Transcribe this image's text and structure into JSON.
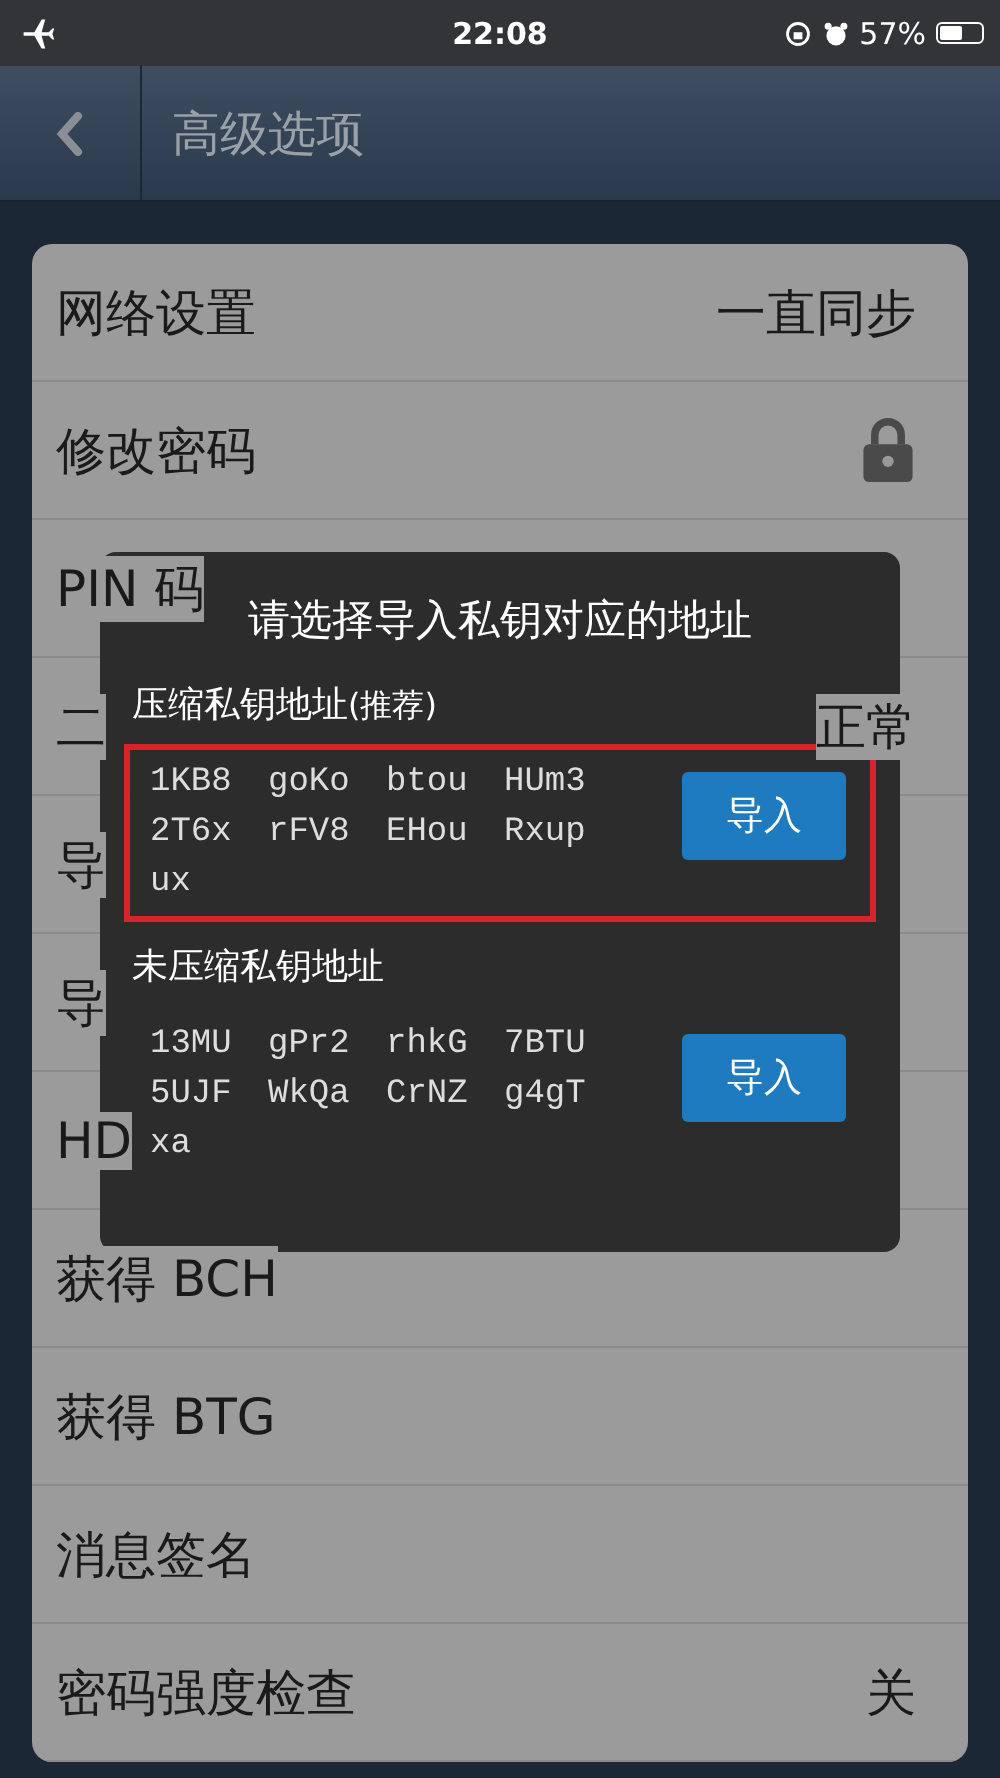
{
  "status_bar": {
    "time": "22:08",
    "battery_percent": "57%",
    "battery": {
      "level": 0.57
    }
  },
  "nav": {
    "title": "高级选项"
  },
  "settings": [
    {
      "kind": "value",
      "label": "网络设置",
      "value": "一直同步"
    },
    {
      "kind": "lock",
      "label": "修改密码"
    },
    {
      "kind": "plain",
      "label": "PIN 码"
    },
    {
      "kind": "value",
      "label": "二",
      "value": "正常"
    },
    {
      "kind": "plain",
      "label": "导"
    },
    {
      "kind": "plain",
      "label": "导"
    },
    {
      "kind": "plain",
      "label": "HD"
    },
    {
      "kind": "plain",
      "label": "获得 BCH"
    },
    {
      "kind": "plain",
      "label": "获得 BTG"
    },
    {
      "kind": "plain",
      "label": "消息签名"
    },
    {
      "kind": "value",
      "label": "密码强度检查",
      "value": "关"
    }
  ],
  "dialog": {
    "title": "请选择导入私钥对应的地址",
    "options": [
      {
        "label": "压缩私钥地址",
        "label_note": "(推荐)",
        "address": "1KB8 goKo btou HUm3 2T6x rFV8 EHou Rxup ux",
        "button": "导入",
        "highlighted": true
      },
      {
        "label": "未压缩私钥地址",
        "address": "13MU gPr2 rhkG 7BTU 5UJF WkQa CrNZ g4gT xa",
        "button": "导入",
        "highlighted": false
      }
    ]
  }
}
